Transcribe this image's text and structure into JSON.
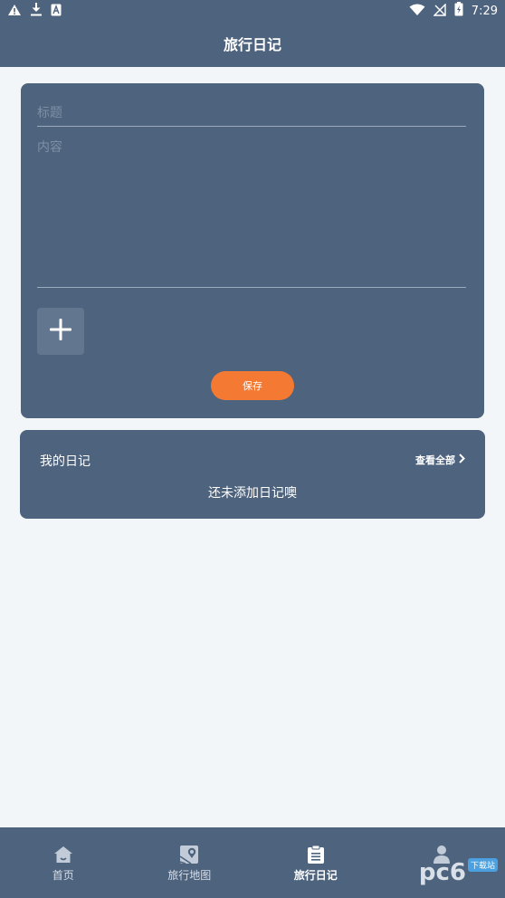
{
  "status_bar": {
    "time": "7:29",
    "left_icons": [
      "warning-icon",
      "download-icon",
      "font-icon"
    ],
    "right_icons": [
      "wifi-icon",
      "no-signal-icon",
      "battery-charging-icon"
    ]
  },
  "header": {
    "title": "旅行日记"
  },
  "editor": {
    "title_placeholder": "标题",
    "content_placeholder": "内容",
    "add_icon": "plus-icon",
    "save_label": "保存"
  },
  "my_diary": {
    "title": "我的日记",
    "view_all": "查看全部",
    "empty_text": "还未添加日记噢"
  },
  "bottom_nav": {
    "items": [
      {
        "label": "首页",
        "icon": "home-icon",
        "active": false
      },
      {
        "label": "旅行地图",
        "icon": "map-icon",
        "active": false
      },
      {
        "label": "旅行日记",
        "icon": "diary-icon",
        "active": true
      },
      {
        "label": "",
        "icon": "user-icon",
        "active": false
      }
    ]
  },
  "watermark": {
    "text": "pc6",
    "badge": "下载站"
  },
  "colors": {
    "primary": "#4e637d",
    "background": "#f3f6f9",
    "accent": "#f47a33"
  }
}
